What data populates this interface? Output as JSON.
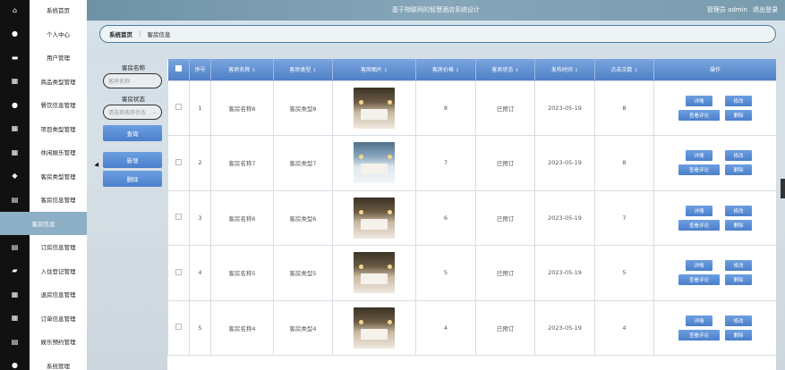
{
  "header": {
    "title": "基于物联网的智慧酒店系统设计",
    "user": "管理员 admin",
    "logout": "退出登录"
  },
  "sidebar": {
    "items": [
      {
        "label": "系统首页",
        "icon": "home-icon",
        "glyph": "⌂"
      },
      {
        "label": "个人中心",
        "icon": "user-icon",
        "glyph": "●"
      },
      {
        "label": "用户管理",
        "icon": "chat-icon",
        "glyph": "▬"
      },
      {
        "label": "商品类型管理",
        "icon": "grid-icon",
        "glyph": "▦"
      },
      {
        "label": "餐饮信息管理",
        "icon": "user-icon",
        "glyph": "●"
      },
      {
        "label": "项目类型管理",
        "icon": "grid-icon",
        "glyph": "▦"
      },
      {
        "label": "休闲娱乐管理",
        "icon": "grid-icon",
        "glyph": "▦"
      },
      {
        "label": "客房类型管理",
        "icon": "pin-icon",
        "glyph": "◆"
      },
      {
        "label": "客房信息管理",
        "icon": "clipboard-icon",
        "glyph": "▤"
      },
      {
        "label": "客房信息",
        "icon": "",
        "glyph": "",
        "active": true
      },
      {
        "label": "订房信息管理",
        "icon": "list-icon",
        "glyph": "▤"
      },
      {
        "label": "入住登记管理",
        "icon": "briefcase-icon",
        "glyph": "▰"
      },
      {
        "label": "退房信息管理",
        "icon": "grid-icon",
        "glyph": "▦"
      },
      {
        "label": "订单信息管理",
        "icon": "grid-icon",
        "glyph": "▦"
      },
      {
        "label": "娱乐预约管理",
        "icon": "clipboard-icon",
        "glyph": "▤"
      },
      {
        "label": "系统管理",
        "icon": "user-icon",
        "glyph": "●"
      }
    ]
  },
  "breadcrumb": {
    "home": "系统首页",
    "sep": "⋮",
    "current": "客房信息"
  },
  "search": {
    "name_label": "客房名称",
    "name_placeholder": "客房名称",
    "status_label": "客房状态",
    "status_placeholder": "请选择客房状态",
    "query_button": "查询",
    "add_button": "新增",
    "delete_button": "删除"
  },
  "table": {
    "headers": [
      "序号",
      "客房名称",
      "客房类型",
      "客房图片",
      "客房价格",
      "客房状态",
      "发布时间",
      "点击次数",
      "操作"
    ],
    "buttons": {
      "detail": "详情",
      "edit": "修改",
      "review": "查看评论",
      "delete": "删除"
    },
    "rows": [
      {
        "index": "1",
        "name": "客房名称8",
        "type": "客房类型8",
        "price": "8",
        "status": "已预订",
        "date": "2023-05-19",
        "clicks": "8"
      },
      {
        "index": "2",
        "name": "客房名称7",
        "type": "客房类型7",
        "price": "7",
        "status": "已预订",
        "date": "2023-05-19",
        "clicks": "8"
      },
      {
        "index": "3",
        "name": "客房名称6",
        "type": "客房类型6",
        "price": "6",
        "status": "已预订",
        "date": "2023-05-19",
        "clicks": "7"
      },
      {
        "index": "4",
        "name": "客房名称5",
        "type": "客房类型5",
        "price": "5",
        "status": "已预订",
        "date": "2023-05-19",
        "clicks": "5"
      },
      {
        "index": "5",
        "name": "客房名称4",
        "type": "客房类型4",
        "price": "4",
        "status": "已预订",
        "date": "2023-05-19",
        "clicks": "4"
      }
    ]
  },
  "colors": {
    "accent": "#4f80c7",
    "header": "#7a9caf",
    "sidebar_active": "#8db0c6"
  }
}
